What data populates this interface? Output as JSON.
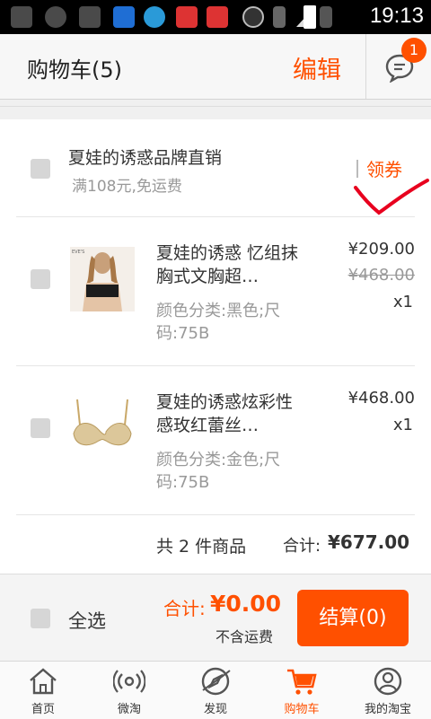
{
  "status_bar": {
    "time": "19:13"
  },
  "header": {
    "title": "购物车(5)",
    "edit_label": "编辑",
    "message_badge": "1"
  },
  "shop": {
    "name": "夏娃的诱惑品牌直销",
    "promo": "满108元,免运费",
    "coupon_label": "领券"
  },
  "items": [
    {
      "title": "夏娃的诱惑 忆组抹胸式文胸超…",
      "sku": "颜色分类:黑色;尺码:75B",
      "price": "¥209.00",
      "original_price": "¥468.00",
      "qty": "x1",
      "thumb_icon": "bra-model-photo"
    },
    {
      "title": "夏娃的诱惑炫彩性感玫红蕾丝…",
      "sku": "颜色分类:金色;尺码:75B",
      "price": "¥468.00",
      "qty": "x1",
      "thumb_icon": "gold-bra-photo"
    }
  ],
  "shop_summary": {
    "count": "共 2 件商品",
    "total_label": "合计:",
    "total": "¥677.00"
  },
  "footer": {
    "select_all": "全选",
    "total_label": "合计:",
    "total_value": "¥0.00",
    "no_shipping": "不含运费",
    "checkout": "结算(0)"
  },
  "tabs": [
    {
      "label": "首页",
      "icon": "home-icon"
    },
    {
      "label": "微淘",
      "icon": "broadcast-icon"
    },
    {
      "label": "发现",
      "icon": "discover-icon"
    },
    {
      "label": "购物车",
      "icon": "cart-icon"
    },
    {
      "label": "我的淘宝",
      "icon": "profile-icon"
    }
  ],
  "colors": {
    "accent": "#ff5000",
    "muted": "#999999"
  }
}
